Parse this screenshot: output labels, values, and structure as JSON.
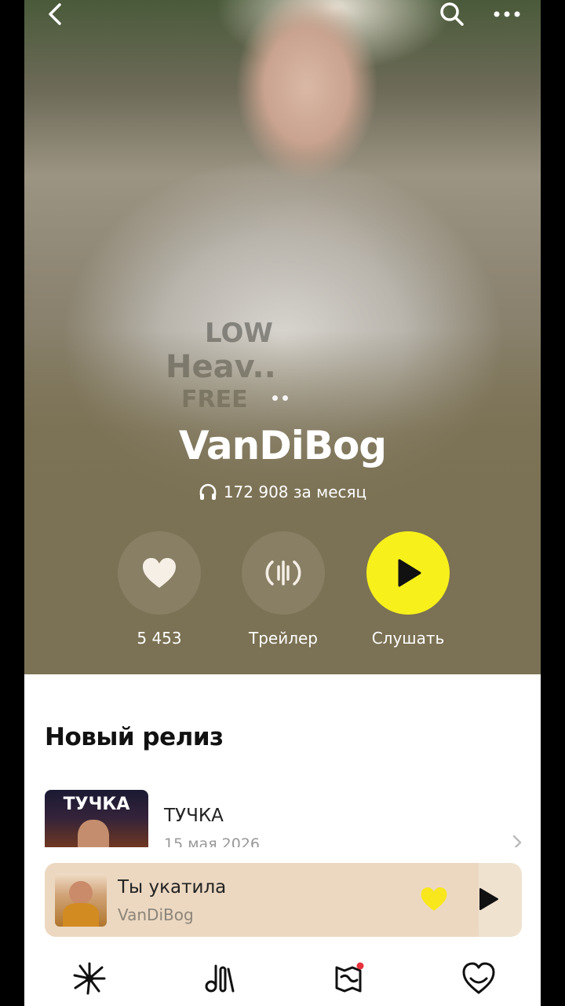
{
  "artist": {
    "name": "VanDiBog",
    "monthly_listeners": "172 908 за месяц"
  },
  "actions": {
    "likes_count": "5 453",
    "trailer_label": "Трейлер",
    "listen_label": "Слушать"
  },
  "new_release": {
    "section_title": "Новый релиз",
    "title": "ТУЧКА",
    "date": "15 мая 2026",
    "cover_text": "ТУЧКА"
  },
  "now_playing": {
    "title": "Ты укатила",
    "artist": "VanDiBog",
    "progress_percent": 91,
    "liked": true
  },
  "colors": {
    "hero_bg": "#7b7154",
    "accent_yellow": "#f7f01b",
    "player_bg": "#efe2cf"
  },
  "icons": {
    "top": [
      "back-arrow-icon",
      "search-icon",
      "more-icon"
    ],
    "nav": [
      "my-wave-icon",
      "library-icon",
      "map-icon",
      "favorites-icon"
    ]
  }
}
